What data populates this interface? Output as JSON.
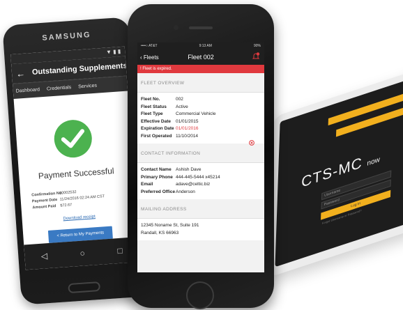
{
  "tablet": {
    "title": "CTS-MC",
    "title_suffix": "now",
    "username_placeholder": "Username",
    "password_placeholder": "Password",
    "login_label": "Log In",
    "footer_text": "Forgot Username or Password?"
  },
  "samsung": {
    "brand": "SAMSUNG",
    "screen_title": "Outstanding Supplements",
    "tabs": [
      "Dashboard",
      "Credentials",
      "Services"
    ],
    "payment_title": "Payment Successful",
    "details": [
      {
        "label": "Confirmation No.",
        "value": "20002532"
      },
      {
        "label": "Payment Date",
        "value": "11/24/2016 02:24 AM CST"
      },
      {
        "label": "Amount Paid",
        "value": "$72.67"
      }
    ],
    "download_link": "Download receipt",
    "return_button": "< Return to My Payments"
  },
  "iphone": {
    "status_left": "••••○ AT&T",
    "status_time": "9:13 AM",
    "status_right": "90%",
    "back_label": "Fleets",
    "nav_title": "Fleet 002",
    "banner_text": "! Fleet is expired.",
    "fleet_overview_heading": "FLEET OVERVIEW",
    "fleet": [
      {
        "label": "Fleet No.",
        "value": "002",
        "alert": false
      },
      {
        "label": "Fleet Status",
        "value": "Active",
        "alert": false
      },
      {
        "label": "Fleet Type",
        "value": "Commercial Vehicle",
        "alert": false
      },
      {
        "label": "Effective Date",
        "value": "01/01/2015",
        "alert": false
      },
      {
        "label": "Expiration Date",
        "value": "01/01/2016",
        "alert": true
      },
      {
        "label": "First Operated",
        "value": "11/10/2014",
        "alert": false
      }
    ],
    "contact_heading": "CONTACT INFORMATION",
    "contact": [
      {
        "label": "Contact Name",
        "value": "Ashish Dave"
      },
      {
        "label": "Primary Phone",
        "value": "444-445-5444 x45214"
      },
      {
        "label": "Email",
        "value": "adave@celtic.biz"
      },
      {
        "label": "Preferred Office",
        "value": "Anderson"
      }
    ],
    "mailing_heading": "MAILING ADDRESS",
    "address_line1": "12345 Noname St, Suite 191",
    "address_line2": "Randall, KS 66963"
  },
  "colors": {
    "accent_red": "#e0393e",
    "success_green": "#4cb24f",
    "button_blue": "#3a7ac3",
    "tablet_yellow": "#f2b01e"
  }
}
